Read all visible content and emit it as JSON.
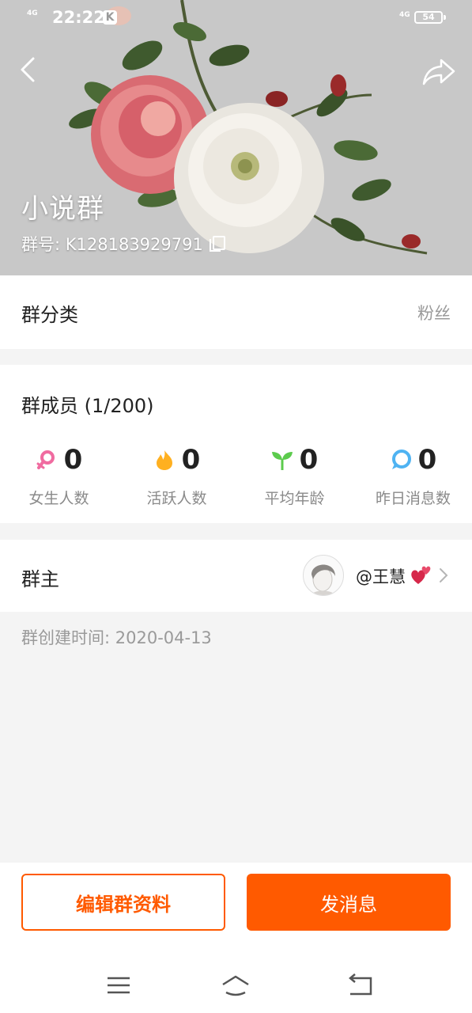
{
  "status_bar": {
    "network": "4G",
    "time": "22:22",
    "app_badge": "K",
    "network_right": "4G",
    "battery": "54"
  },
  "header": {
    "group_name": "小说群",
    "group_id": "群号: K128183929791"
  },
  "category": {
    "label": "群分类",
    "value": "粉丝"
  },
  "members": {
    "title": "群成员 (1/200)",
    "stats": [
      {
        "icon": "female-icon",
        "value": "0",
        "label": "女生人数",
        "color": "#f06ba0"
      },
      {
        "icon": "flame-icon",
        "value": "0",
        "label": "活跃人数",
        "color": "#ffb020"
      },
      {
        "icon": "sprout-icon",
        "value": "0",
        "label": "平均年龄",
        "color": "#5ccb4d"
      },
      {
        "icon": "chat-bubble-icon",
        "value": "0",
        "label": "昨日消息数",
        "color": "#4fb3f2"
      }
    ]
  },
  "owner": {
    "label": "群主",
    "name": "@王慧"
  },
  "created_text": "群创建时间: 2020-04-13",
  "buttons": {
    "edit": "编辑群资料",
    "send": "发消息"
  },
  "colors": {
    "accent": "#ff5a00",
    "header_bg": "#c8c8c8"
  }
}
